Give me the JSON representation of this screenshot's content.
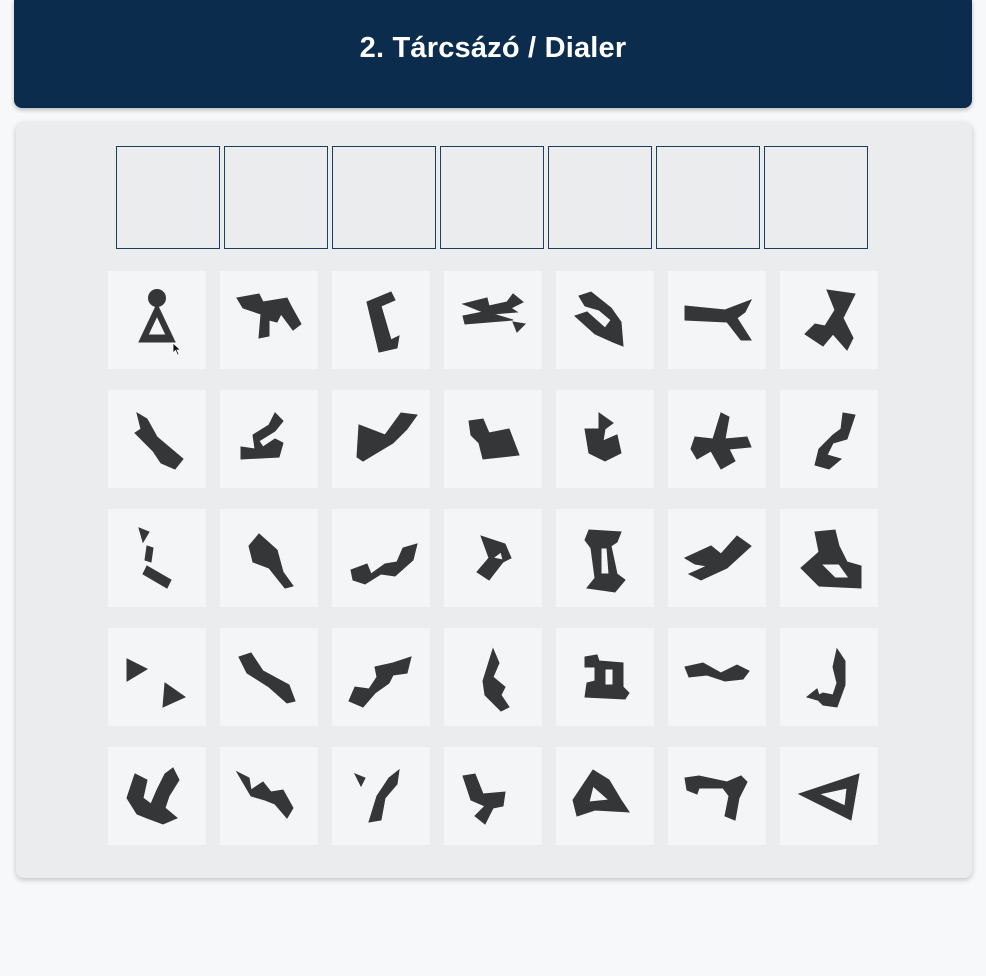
{
  "header": {
    "title": "2. Tárcsázó / Dialer"
  },
  "colors": {
    "header_bg": "#0b2c4c",
    "panel_bg": "#ebeced",
    "glyph": "#343638",
    "slot_border": "#1e3d5c"
  },
  "dial_slots": [
    "",
    "",
    "",
    "",
    "",
    "",
    ""
  ],
  "glyphs": [
    "glyph-point-of-origin-icon",
    "glyph-02-icon",
    "glyph-03-icon",
    "glyph-04-icon",
    "glyph-05-icon",
    "glyph-06-icon",
    "glyph-07-icon",
    "glyph-08-icon",
    "glyph-09-icon",
    "glyph-10-icon",
    "glyph-11-icon",
    "glyph-12-icon",
    "glyph-13-icon",
    "glyph-14-icon",
    "glyph-15-icon",
    "glyph-16-icon",
    "glyph-17-icon",
    "glyph-18-icon",
    "glyph-19-icon",
    "glyph-20-icon",
    "glyph-21-icon",
    "glyph-22-icon",
    "glyph-23-icon",
    "glyph-24-icon",
    "glyph-25-icon",
    "glyph-26-icon",
    "glyph-27-icon",
    "glyph-28-icon",
    "glyph-29-icon",
    "glyph-30-icon",
    "glyph-31-icon",
    "glyph-32-icon",
    "glyph-33-icon",
    "glyph-34-icon",
    "glyph-35-icon"
  ]
}
